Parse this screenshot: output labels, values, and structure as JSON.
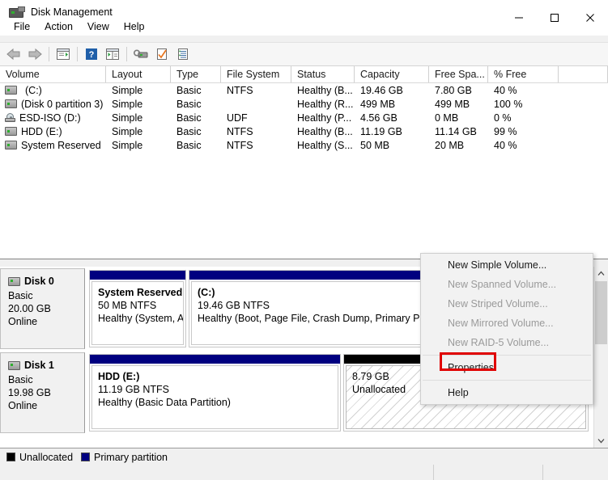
{
  "window": {
    "title": "Disk Management",
    "icon": "disk-management-icon",
    "minimize_label": "—",
    "maximize_label": "□",
    "close_label": "✕"
  },
  "menubar": {
    "items": [
      {
        "label": "File",
        "name": "menu-file"
      },
      {
        "label": "Action",
        "name": "menu-action"
      },
      {
        "label": "View",
        "name": "menu-view"
      },
      {
        "label": "Help",
        "name": "menu-help"
      }
    ]
  },
  "toolbar": {
    "buttons": [
      {
        "name": "back-icon",
        "title": "Back"
      },
      {
        "name": "forward-icon",
        "title": "Forward"
      },
      {
        "name": "show-hide-console-tree-icon",
        "title": "Show/Hide Console Tree"
      },
      {
        "name": "help-icon",
        "title": "Help"
      },
      {
        "name": "show-hide-action-pane-icon",
        "title": "Show/Hide Action Pane"
      },
      {
        "name": "refresh-icon",
        "title": "Refresh"
      },
      {
        "name": "rescan-disks-icon",
        "title": "Rescan Disks"
      },
      {
        "name": "properties-icon",
        "title": "Properties"
      }
    ]
  },
  "volume_list": {
    "columns": [
      {
        "label": "Volume",
        "width": 131
      },
      {
        "label": "Layout",
        "width": 80
      },
      {
        "label": "Type",
        "width": 62
      },
      {
        "label": "File System",
        "width": 87
      },
      {
        "label": "Status",
        "width": 78
      },
      {
        "label": "Capacity",
        "width": 92
      },
      {
        "label": "Free Spa...",
        "width": 73
      },
      {
        "label": "% Free",
        "width": 87
      },
      {
        "label": "",
        "width": 61
      }
    ],
    "rows": [
      {
        "icon": "drive-icon",
        "volume": "(C:)",
        "indent": true,
        "layout": "Simple",
        "type": "Basic",
        "file_system": "NTFS",
        "status": "Healthy (B...",
        "capacity": "19.46 GB",
        "free_space": "7.80 GB",
        "percent_free": "40 %"
      },
      {
        "icon": "drive-icon",
        "volume": "(Disk 0 partition 3)",
        "indent": false,
        "layout": "Simple",
        "type": "Basic",
        "file_system": "",
        "status": "Healthy (R...",
        "capacity": "499 MB",
        "free_space": "499 MB",
        "percent_free": "100 %"
      },
      {
        "icon": "cd-drive-icon",
        "volume": "ESD-ISO (D:)",
        "indent": false,
        "layout": "Simple",
        "type": "Basic",
        "file_system": "UDF",
        "status": "Healthy (P...",
        "capacity": "4.56 GB",
        "free_space": "0 MB",
        "percent_free": "0 %"
      },
      {
        "icon": "drive-icon",
        "volume": "HDD (E:)",
        "indent": false,
        "layout": "Simple",
        "type": "Basic",
        "file_system": "NTFS",
        "status": "Healthy (B...",
        "capacity": "11.19 GB",
        "free_space": "11.14 GB",
        "percent_free": "99 %"
      },
      {
        "icon": "drive-icon",
        "volume": "System Reserved",
        "indent": false,
        "layout": "Simple",
        "type": "Basic",
        "file_system": "NTFS",
        "status": "Healthy (S...",
        "capacity": "50 MB",
        "free_space": "20 MB",
        "percent_free": "40 %"
      }
    ]
  },
  "disks": [
    {
      "name": "Disk 0",
      "type": "Basic",
      "size": "20.00 GB",
      "state": "Online",
      "partitions": [
        {
          "name": "System Reserved",
          "size_fs": "50 MB NTFS",
          "status": "Healthy (System, Ac",
          "kind": "primary",
          "flex": 120
        },
        {
          "name": "(C:)",
          "size_fs": "19.46 GB NTFS",
          "status": "Healthy (Boot, Page File, Crash Dump, Primary Partiti",
          "kind": "primary",
          "flex": 494
        }
      ]
    },
    {
      "name": "Disk 1",
      "type": "Basic",
      "size": "19.98 GB",
      "state": "Online",
      "partitions": [
        {
          "name": "HDD  (E:)",
          "size_fs": "11.19 GB NTFS",
          "status": "Healthy (Basic Data Partition)",
          "kind": "primary",
          "flex": 311
        },
        {
          "name": "",
          "size_fs": "8.79 GB",
          "status": "Unallocated",
          "kind": "unallocated",
          "flex": 303
        }
      ]
    }
  ],
  "context_menu": {
    "items": [
      {
        "label": "New Simple Volume...",
        "disabled": false,
        "name": "ctx-new-simple-volume"
      },
      {
        "label": "New Spanned Volume...",
        "disabled": true,
        "name": "ctx-new-spanned-volume"
      },
      {
        "label": "New Striped Volume...",
        "disabled": true,
        "name": "ctx-new-striped-volume"
      },
      {
        "label": "New Mirrored Volume...",
        "disabled": true,
        "name": "ctx-new-mirrored-volume"
      },
      {
        "label": "New RAID-5 Volume...",
        "disabled": true,
        "name": "ctx-new-raid5-volume"
      },
      {
        "separator": true
      },
      {
        "label": "Properties",
        "disabled": false,
        "name": "ctx-properties",
        "highlighted": true
      },
      {
        "separator": true
      },
      {
        "label": "Help",
        "disabled": false,
        "name": "ctx-help"
      }
    ]
  },
  "legend": {
    "items": [
      {
        "label": "Unallocated",
        "color": "#000000"
      },
      {
        "label": "Primary partition",
        "color": "#000080"
      }
    ]
  },
  "colors": {
    "primary_partition": "#000080",
    "unallocated": "#000000",
    "annotation_red": "#e00000"
  },
  "scrollbar": {
    "up_arrow": "⌃",
    "down_arrow": "⌄"
  },
  "statusbar": {
    "panes": [
      "",
      "",
      ""
    ]
  }
}
